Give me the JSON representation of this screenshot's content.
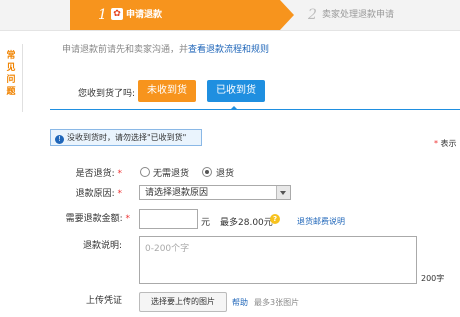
{
  "steps": [
    {
      "num": "1",
      "label": "申请退款",
      "active": true
    },
    {
      "num": "2",
      "label": "卖家处理退款申请",
      "active": false
    }
  ],
  "sidebar": {
    "tab_label": "常见问题"
  },
  "intro": {
    "text": "申请退款前请先和卖家沟通，并",
    "link": "查看退款流程和规则"
  },
  "received": {
    "question": "您收到货了吗:",
    "not_received_label": "未收到货",
    "received_label": "已收到货",
    "notice": "没收到货时，请勿选择\"已收到货\""
  },
  "form": {
    "required_note_star": "*",
    "required_note": "表示",
    "return_goods": {
      "label": "是否退货:",
      "star": "*",
      "options": [
        "无需退货",
        "退货"
      ],
      "selected": "退货"
    },
    "reason": {
      "label": "退款原因:",
      "star": "*",
      "placeholder": "请选择退款原因"
    },
    "amount": {
      "label": "需要退款金额:",
      "star": "*",
      "value": "",
      "unit": "元",
      "max_text": "最多28.00元",
      "policy_link": "退货邮费说明"
    },
    "description": {
      "label": "退款说明:",
      "placeholder": "0-200个字",
      "limit": "200字"
    },
    "upload": {
      "label": "上传凭证",
      "button": "选择要上传的图片",
      "help_link": "帮助",
      "max_text": "最多3张图片"
    }
  },
  "colors": {
    "accent_orange": "#f7941d",
    "accent_blue": "#1f8fe0",
    "link": "#1f66b9"
  }
}
